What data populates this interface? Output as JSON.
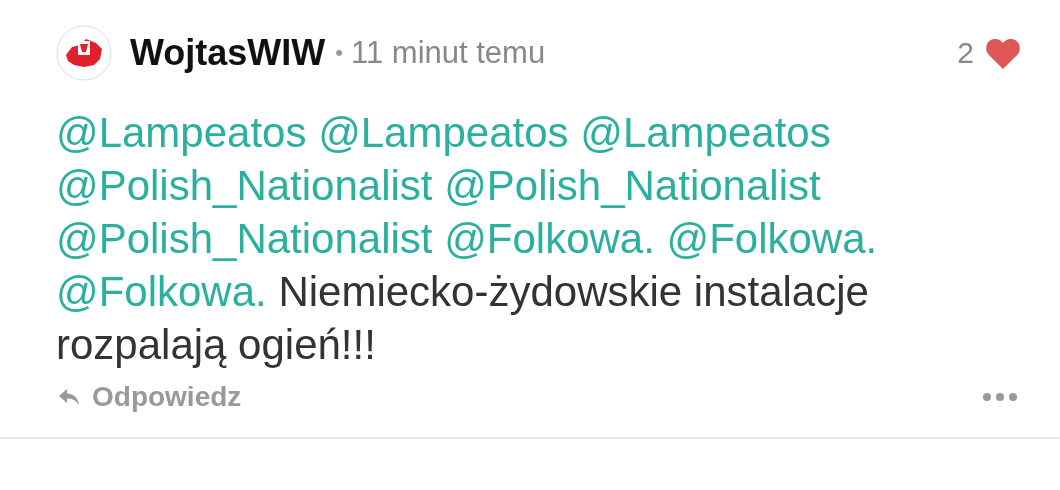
{
  "comment": {
    "author": "WojtasWIW",
    "separator": "•",
    "time": "11 minut temu",
    "likes": "2",
    "liked": true,
    "body": [
      {
        "kind": "mention",
        "text": "@Lampeatos"
      },
      {
        "kind": "mention",
        "text": "@Lampeatos"
      },
      {
        "kind": "mention",
        "text": "@Lampeatos"
      },
      {
        "kind": "mention",
        "text": "@Polish_Nationalist"
      },
      {
        "kind": "mention",
        "text": "@Polish_Nationalist"
      },
      {
        "kind": "mention",
        "text": "@Polish_Nationalist"
      },
      {
        "kind": "mention",
        "text": "@Folkowa."
      },
      {
        "kind": "mention",
        "text": "@Folkowa."
      },
      {
        "kind": "mention",
        "text": "@Folkowa."
      },
      {
        "kind": "text",
        "text": "Niemiecko-żydowskie instalacje rozpalają ogień!!!"
      }
    ],
    "reply": "Odpowiedz"
  }
}
